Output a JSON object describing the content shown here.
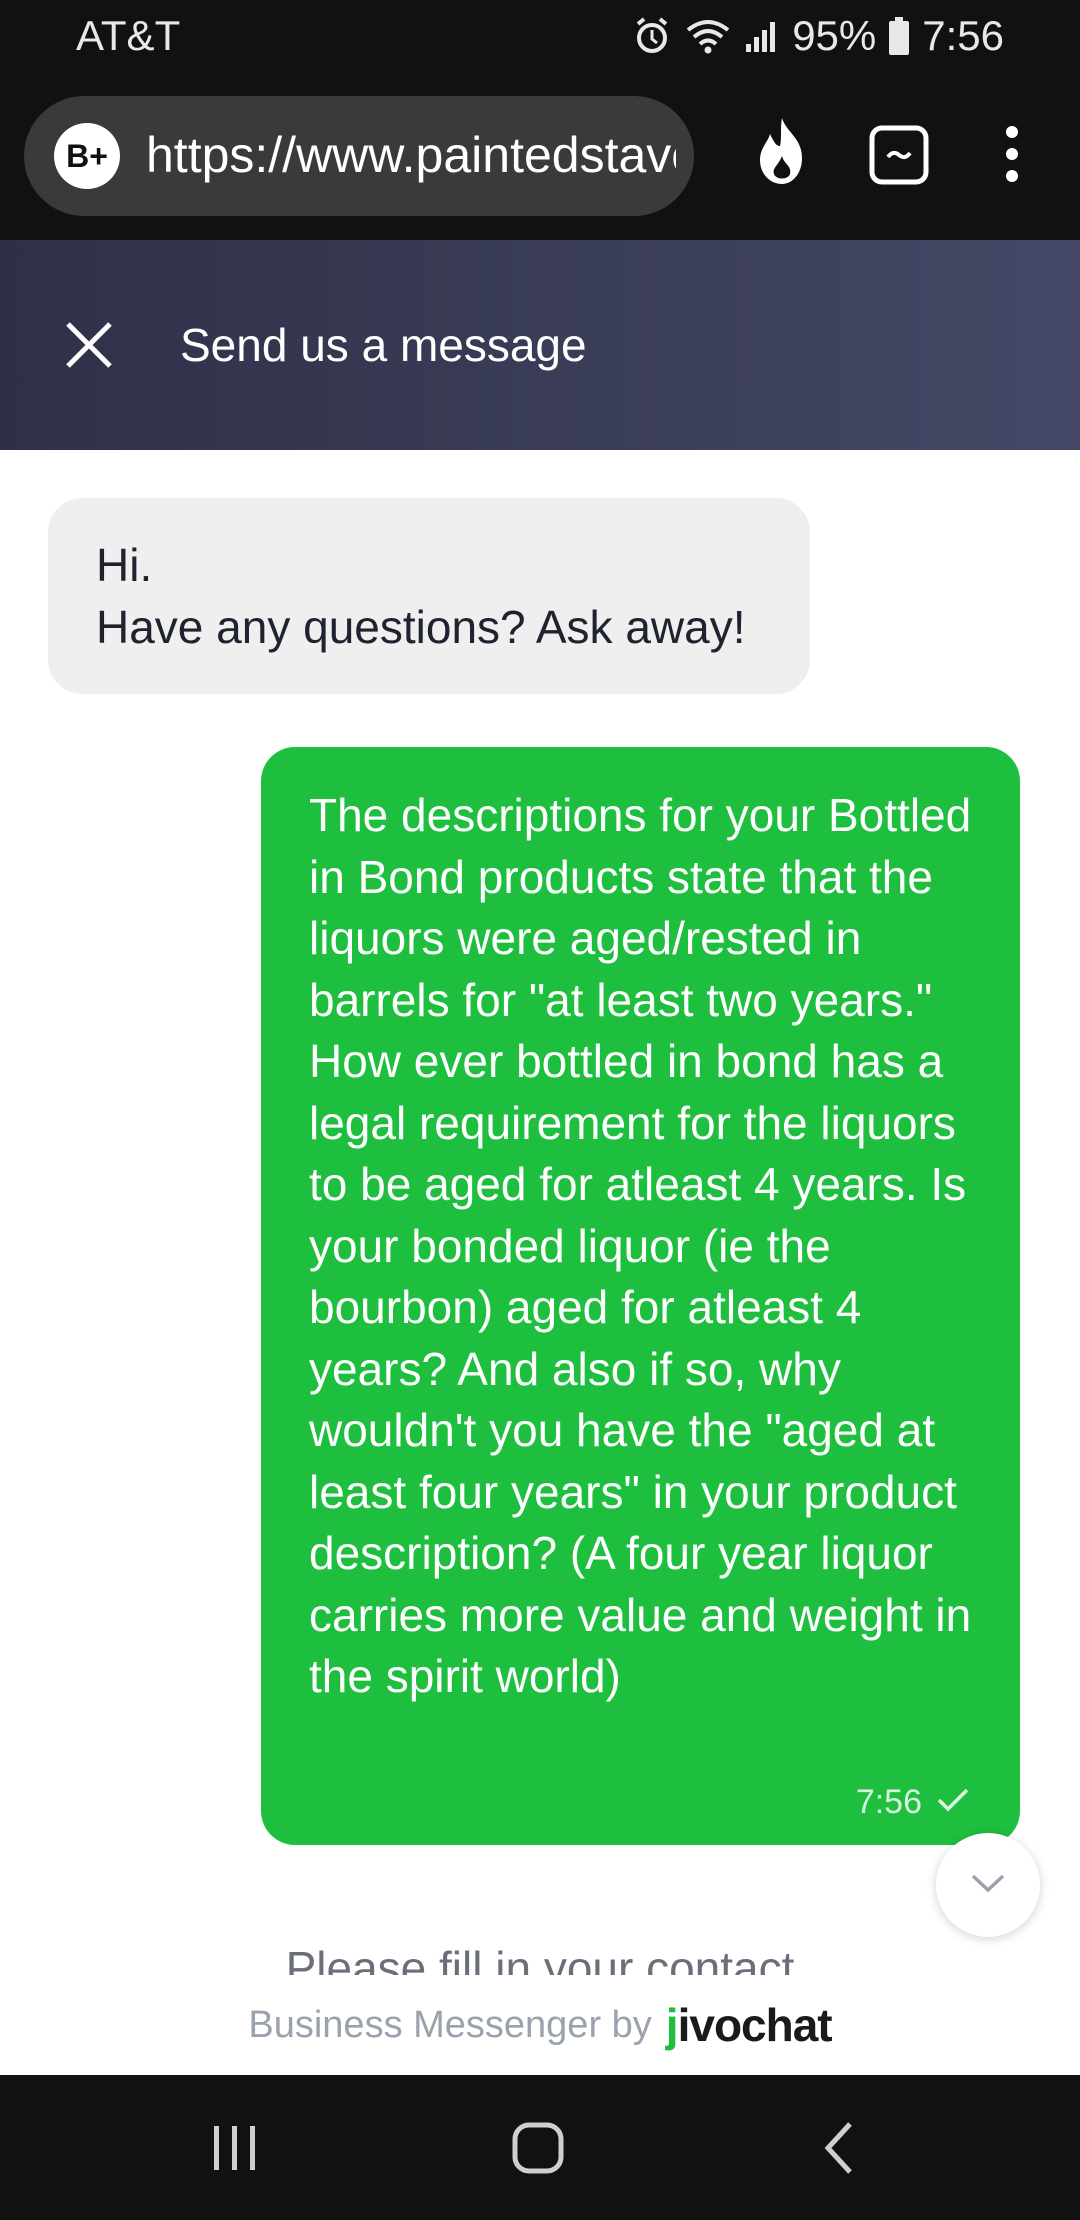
{
  "status_bar": {
    "carrier": "AT&T",
    "battery": "95%",
    "time": "7:56"
  },
  "browser": {
    "site_badge": "B+",
    "url": "https://www.paintedstave.com"
  },
  "chat_header": {
    "title": "Send us a message"
  },
  "messages": [
    {
      "direction": "incoming",
      "lines": [
        "Hi.",
        "Have any questions? Ask away!"
      ]
    },
    {
      "direction": "outgoing",
      "text": "The descriptions for your Bottled in Bond products state that the liquors were aged/rested in barrels for \"at least two years.\" How ever bottled in bond has a legal requirement for the liquors to be aged for atleast 4 years. Is your bonded liquor (ie the bourbon) aged for atleast 4 years? And also if so, why wouldn't you have the \"aged at least four years\" in your product description? (A four year liquor carries more value and weight in the spirit world)",
      "time": "7:56",
      "status": "sent"
    }
  ],
  "contact_prompt": "Please fill in your contact",
  "footer": {
    "by_label": "Business Messenger by",
    "brand": "jivochat"
  },
  "colors": {
    "header_start": "#2f3048",
    "header_end": "#444866",
    "outgoing_bubble": "#1ebf3e",
    "incoming_bubble": "#efefef"
  }
}
